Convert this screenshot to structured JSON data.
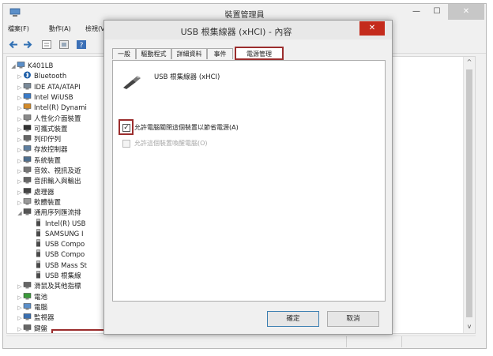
{
  "main_window": {
    "title": "裝置管理員",
    "controls": {
      "minimize": "—",
      "maximize": "☐",
      "close": "✕"
    },
    "menu": [
      "檔案(F)",
      "動作(A)",
      "檢視(V)"
    ],
    "toolbar_icons": [
      "back-arrow-icon",
      "forward-arrow-icon",
      "properties-icon",
      "update-icon",
      "help-icon"
    ],
    "tree": [
      {
        "label": "K401LB",
        "icon": "computer-icon",
        "indent": 0,
        "expand": "◢"
      },
      {
        "label": "Bluetooth",
        "icon": "bluetooth-icon",
        "indent": 1,
        "expand": "▷"
      },
      {
        "label": "IDE ATA/ATAPI",
        "icon": "ide-controller-icon",
        "indent": 1,
        "expand": "▷"
      },
      {
        "label": "Intel WiUSB",
        "icon": "wiusb-icon",
        "indent": 1,
        "expand": "▷"
      },
      {
        "label": "Intel(R) Dynami",
        "icon": "intel-dynamic-icon",
        "indent": 1,
        "expand": "▷"
      },
      {
        "label": "人性化介面裝置",
        "icon": "hid-icon",
        "indent": 1,
        "expand": "▷"
      },
      {
        "label": "可攜式裝置",
        "icon": "portable-device-icon",
        "indent": 1,
        "expand": "▷"
      },
      {
        "label": "列印佇列",
        "icon": "print-queue-icon",
        "indent": 1,
        "expand": "▷"
      },
      {
        "label": "存放控制器",
        "icon": "storage-controller-icon",
        "indent": 1,
        "expand": "▷"
      },
      {
        "label": "系統裝置",
        "icon": "system-device-icon",
        "indent": 1,
        "expand": "▷"
      },
      {
        "label": "音效、視訊及遊",
        "icon": "audio-icon",
        "indent": 1,
        "expand": "▷"
      },
      {
        "label": "音訊輸入與輸出",
        "icon": "audio-io-icon",
        "indent": 1,
        "expand": "▷"
      },
      {
        "label": "處理器",
        "icon": "processor-icon",
        "indent": 1,
        "expand": "▷"
      },
      {
        "label": "軟體裝置",
        "icon": "software-device-icon",
        "indent": 1,
        "expand": "▷"
      },
      {
        "label": "通用序列匯流排",
        "icon": "usb-bus-icon",
        "indent": 1,
        "expand": "◢"
      },
      {
        "label": "Intel(R) USB",
        "icon": "usb-plug-icon",
        "indent": 2,
        "expand": ""
      },
      {
        "label": "SAMSUNG I",
        "icon": "usb-plug-icon",
        "indent": 2,
        "expand": ""
      },
      {
        "label": "USB Compo",
        "icon": "usb-plug-icon",
        "indent": 2,
        "expand": ""
      },
      {
        "label": "USB Compo",
        "icon": "usb-plug-icon",
        "indent": 2,
        "expand": ""
      },
      {
        "label": "USB Mass St",
        "icon": "usb-plug-icon",
        "indent": 2,
        "expand": ""
      },
      {
        "label": "USB 根集線",
        "icon": "usb-plug-icon",
        "indent": 2,
        "expand": "",
        "highlighted": true
      },
      {
        "label": "滑鼠及其他指標",
        "icon": "mouse-icon",
        "indent": 1,
        "expand": "▷"
      },
      {
        "label": "電池",
        "icon": "battery-icon",
        "indent": 1,
        "expand": "▷"
      },
      {
        "label": "電腦",
        "icon": "computer-icon",
        "indent": 1,
        "expand": "▷"
      },
      {
        "label": "監視器",
        "icon": "monitor-icon",
        "indent": 1,
        "expand": "▷"
      },
      {
        "label": "鍵盤",
        "icon": "keyboard-icon",
        "indent": 1,
        "expand": "▷"
      }
    ],
    "scroll": {
      "up": "^",
      "down": "v"
    }
  },
  "dialog": {
    "title": "USB 根集線器 (xHCI) - 內容",
    "close": "✕",
    "tabs": [
      "一般",
      "驅動程式",
      "詳細資料",
      "事件",
      "電源管理"
    ],
    "active_tab": "電源管理",
    "device_name": "USB 根集線器 (xHCI)",
    "options": [
      {
        "label": "允許電腦關閉這個裝置以節省電源(A)",
        "checked": true,
        "enabled": true,
        "mark": "✓"
      },
      {
        "label": "允許這個裝置喚醒電腦(O)",
        "checked": false,
        "enabled": false,
        "mark": ""
      }
    ],
    "buttons": {
      "ok": "確定",
      "cancel": "取消"
    },
    "accent_color": "#9b2d2d",
    "close_color": "#c42b1c"
  }
}
